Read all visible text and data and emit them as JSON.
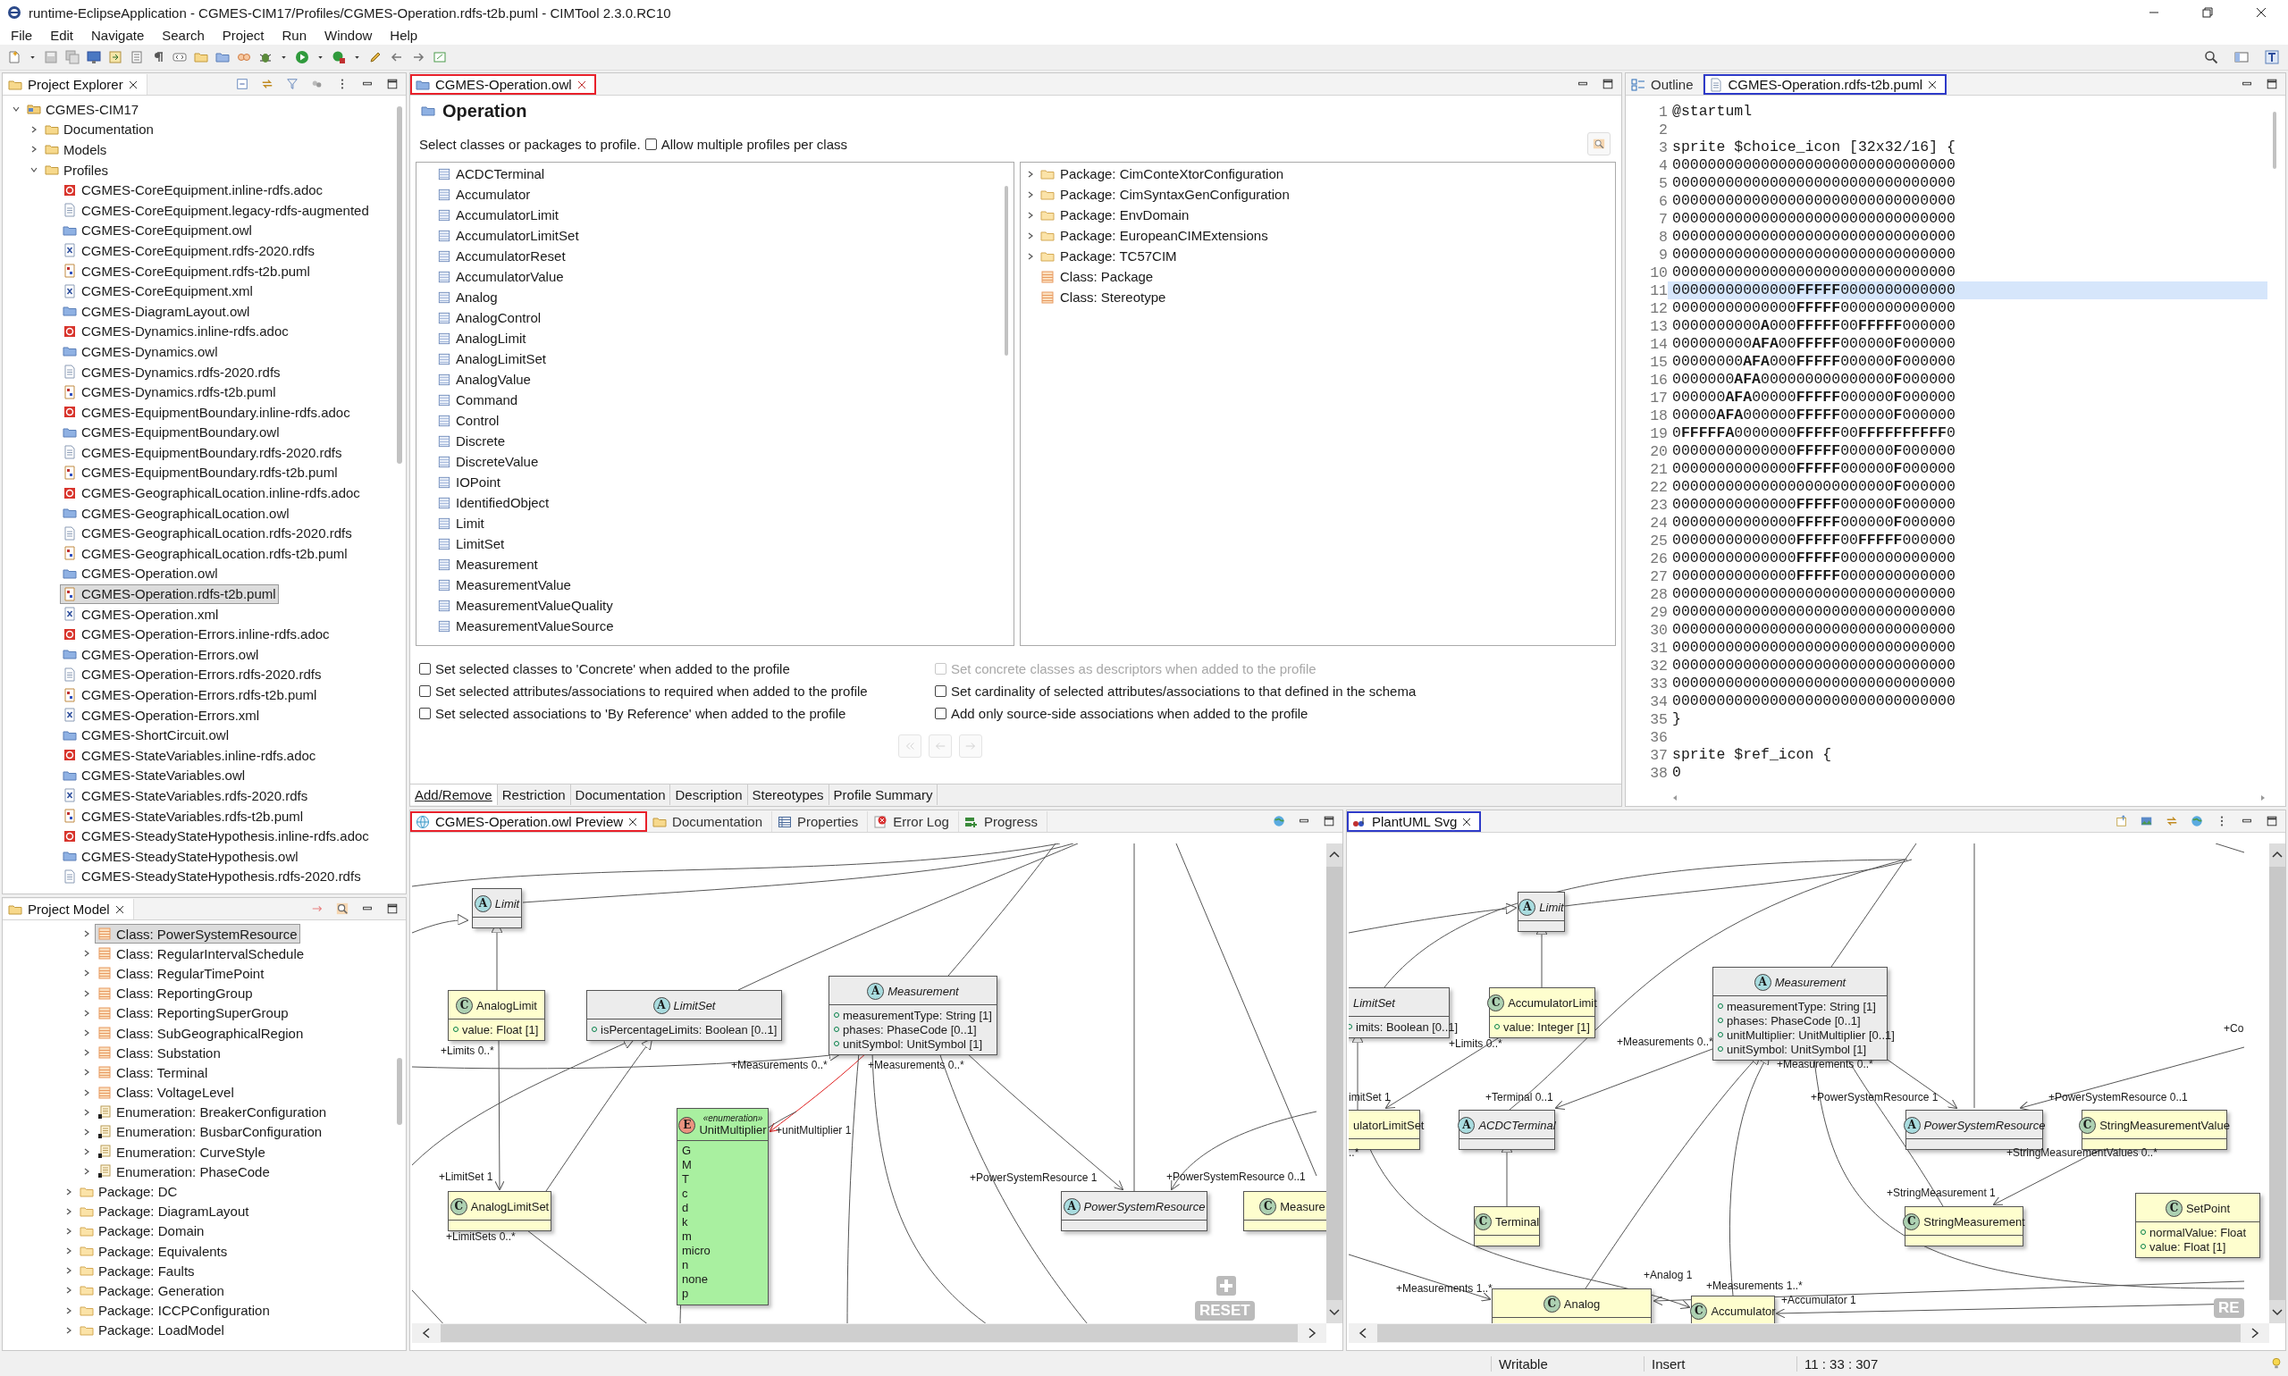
{
  "window": {
    "title": "runtime-EclipseApplication - CGMES-CIM17/Profiles/CGMES-Operation.rdfs-t2b.puml - CIMTool 2.3.0.RC10"
  },
  "menu": [
    "File",
    "Edit",
    "Navigate",
    "Search",
    "Project",
    "Run",
    "Window",
    "Help"
  ],
  "project_explorer": {
    "title": "Project Explorer",
    "tree": [
      {
        "label": "CGMES-CIM17",
        "kind": "project",
        "expanded": true,
        "selected": false,
        "children": [
          {
            "label": "Documentation",
            "kind": "folder",
            "expanded": false,
            "selected": false
          },
          {
            "label": "Models",
            "kind": "folder",
            "expanded": false,
            "selected": false
          },
          {
            "label": "Profiles",
            "kind": "folder",
            "expanded": true,
            "selected": false,
            "children": [
              {
                "label": "CGMES-CoreEquipment.inline-rdfs.adoc",
                "kind": "adoc",
                "selected": false
              },
              {
                "label": "CGMES-CoreEquipment.legacy-rdfs-augmented",
                "kind": "doc",
                "selected": false
              },
              {
                "label": "CGMES-CoreEquipment.owl",
                "kind": "owl",
                "selected": false
              },
              {
                "label": "CGMES-CoreEquipment.rdfs-2020.rdfs",
                "kind": "xml",
                "selected": false
              },
              {
                "label": "CGMES-CoreEquipment.rdfs-t2b.puml",
                "kind": "puml",
                "selected": false
              },
              {
                "label": "CGMES-CoreEquipment.xml",
                "kind": "xml",
                "selected": false
              },
              {
                "label": "CGMES-DiagramLayout.owl",
                "kind": "owl",
                "selected": false
              },
              {
                "label": "CGMES-Dynamics.inline-rdfs.adoc",
                "kind": "adoc",
                "selected": false
              },
              {
                "label": "CGMES-Dynamics.owl",
                "kind": "owl",
                "selected": false
              },
              {
                "label": "CGMES-Dynamics.rdfs-2020.rdfs",
                "kind": "doc",
                "selected": false
              },
              {
                "label": "CGMES-Dynamics.rdfs-t2b.puml",
                "kind": "puml",
                "selected": false
              },
              {
                "label": "CGMES-EquipmentBoundary.inline-rdfs.adoc",
                "kind": "adoc",
                "selected": false
              },
              {
                "label": "CGMES-EquipmentBoundary.owl",
                "kind": "owl",
                "selected": false
              },
              {
                "label": "CGMES-EquipmentBoundary.rdfs-2020.rdfs",
                "kind": "doc",
                "selected": false
              },
              {
                "label": "CGMES-EquipmentBoundary.rdfs-t2b.puml",
                "kind": "puml",
                "selected": false
              },
              {
                "label": "CGMES-GeographicalLocation.inline-rdfs.adoc",
                "kind": "adoc",
                "selected": false
              },
              {
                "label": "CGMES-GeographicalLocation.owl",
                "kind": "owl",
                "selected": false
              },
              {
                "label": "CGMES-GeographicalLocation.rdfs-2020.rdfs",
                "kind": "doc",
                "selected": false
              },
              {
                "label": "CGMES-GeographicalLocation.rdfs-t2b.puml",
                "kind": "puml",
                "selected": false
              },
              {
                "label": "CGMES-Operation.owl",
                "kind": "owl",
                "selected": false
              },
              {
                "label": "CGMES-Operation.rdfs-t2b.puml",
                "kind": "puml",
                "selected": true
              },
              {
                "label": "CGMES-Operation.xml",
                "kind": "xml",
                "selected": false
              },
              {
                "label": "CGMES-Operation-Errors.inline-rdfs.adoc",
                "kind": "adoc",
                "selected": false
              },
              {
                "label": "CGMES-Operation-Errors.owl",
                "kind": "owl",
                "selected": false
              },
              {
                "label": "CGMES-Operation-Errors.rdfs-2020.rdfs",
                "kind": "doc",
                "selected": false
              },
              {
                "label": "CGMES-Operation-Errors.rdfs-t2b.puml",
                "kind": "puml",
                "selected": false
              },
              {
                "label": "CGMES-Operation-Errors.xml",
                "kind": "xml",
                "selected": false
              },
              {
                "label": "CGMES-ShortCircuit.owl",
                "kind": "owl",
                "selected": false
              },
              {
                "label": "CGMES-StateVariables.inline-rdfs.adoc",
                "kind": "adoc",
                "selected": false
              },
              {
                "label": "CGMES-StateVariables.owl",
                "kind": "owl",
                "selected": false
              },
              {
                "label": "CGMES-StateVariables.rdfs-2020.rdfs",
                "kind": "xml",
                "selected": false
              },
              {
                "label": "CGMES-StateVariables.rdfs-t2b.puml",
                "kind": "puml",
                "selected": false
              },
              {
                "label": "CGMES-SteadyStateHypothesis.inline-rdfs.adoc",
                "kind": "adoc",
                "selected": false
              },
              {
                "label": "CGMES-SteadyStateHypothesis.owl",
                "kind": "owl",
                "selected": false
              },
              {
                "label": "CGMES-SteadyStateHypothesis.rdfs-2020.rdfs",
                "kind": "doc",
                "selected": false
              }
            ]
          }
        ]
      }
    ]
  },
  "project_model": {
    "title": "Project Model",
    "tree": [
      {
        "children": [
          {
            "label": "Class: PowerSystemResource",
            "kind": "class",
            "expanded": false,
            "selected": true
          },
          {
            "label": "Class: RegularIntervalSchedule",
            "kind": "class",
            "expanded": false,
            "selected": false
          },
          {
            "label": "Class: RegularTimePoint",
            "kind": "class",
            "expanded": false,
            "selected": false
          },
          {
            "label": "Class: ReportingGroup",
            "kind": "class",
            "expanded": false,
            "selected": false
          },
          {
            "label": "Class: ReportingSuperGroup",
            "kind": "class",
            "expanded": false,
            "selected": false
          },
          {
            "label": "Class: SubGeographicalRegion",
            "kind": "class",
            "expanded": false,
            "selected": false
          },
          {
            "label": "Class: Substation",
            "kind": "class",
            "expanded": false,
            "selected": false
          },
          {
            "label": "Class: Terminal",
            "kind": "class",
            "expanded": false,
            "selected": false
          },
          {
            "label": "Class: VoltageLevel",
            "kind": "class",
            "expanded": false,
            "selected": false
          },
          {
            "label": "Enumeration: BreakerConfiguration",
            "kind": "enum",
            "expanded": false,
            "selected": false
          },
          {
            "label": "Enumeration: BusbarConfiguration",
            "kind": "enum",
            "expanded": false,
            "selected": false
          },
          {
            "label": "Enumeration: CurveStyle",
            "kind": "enum",
            "expanded": false,
            "selected": false
          },
          {
            "label": "Enumeration: PhaseCode",
            "kind": "enum",
            "expanded": false,
            "selected": false
          }
        ]
      },
      {
        "label": "Package: DC",
        "kind": "package",
        "expanded": false,
        "selected": false
      },
      {
        "label": "Package: DiagramLayout",
        "kind": "package",
        "expanded": false,
        "selected": false
      },
      {
        "label": "Package: Domain",
        "kind": "package",
        "expanded": false,
        "selected": false
      },
      {
        "label": "Package: Equivalents",
        "kind": "package",
        "expanded": false,
        "selected": false
      },
      {
        "label": "Package: Faults",
        "kind": "package",
        "expanded": false,
        "selected": false
      },
      {
        "label": "Package: Generation",
        "kind": "package",
        "expanded": false,
        "selected": false
      },
      {
        "label": "Package: ICCPConfiguration",
        "kind": "package",
        "expanded": false,
        "selected": false
      },
      {
        "label": "Package: LoadModel",
        "kind": "package",
        "expanded": false,
        "selected": false
      }
    ]
  },
  "editor": {
    "tabs": [
      {
        "label": "CGMES-Operation.owl",
        "selected": true,
        "color": "#e8202a"
      }
    ],
    "heading": "Operation",
    "prompt": "Select classes or packages to profile.",
    "allow_multiple": {
      "label": "Allow multiple profiles per class",
      "checked": false
    },
    "classes": [
      "ACDCTerminal",
      "Accumulator",
      "AccumulatorLimit",
      "AccumulatorLimitSet",
      "AccumulatorReset",
      "AccumulatorValue",
      "Analog",
      "AnalogControl",
      "AnalogLimit",
      "AnalogLimitSet",
      "AnalogValue",
      "Command",
      "Control",
      "Discrete",
      "DiscreteValue",
      "IOPoint",
      "IdentifiedObject",
      "Limit",
      "LimitSet",
      "Measurement",
      "MeasurementValue",
      "MeasurementValueQuality",
      "MeasurementValueSource"
    ],
    "packages": [
      {
        "label": "Package: CimConteXtorConfiguration",
        "kind": "package",
        "expanded": false
      },
      {
        "label": "Package: CimSyntaxGenConfiguration",
        "kind": "package",
        "expanded": false
      },
      {
        "label": "Package: EnvDomain",
        "kind": "package",
        "expanded": false
      },
      {
        "label": "Package: EuropeanCIMExtensions",
        "kind": "package",
        "expanded": false
      },
      {
        "label": "Package: TC57CIM",
        "kind": "package",
        "expanded": false
      },
      {
        "label": "Class: Package",
        "kind": "class"
      },
      {
        "label": "Class: Stereotype",
        "kind": "class"
      }
    ],
    "options": [
      {
        "label": "Set selected classes to 'Concrete' when added to the profile",
        "checked": false,
        "disabled": false
      },
      {
        "label": "Set concrete classes as descriptors when added to the profile",
        "checked": false,
        "disabled": true
      },
      {
        "label": "Set selected attributes/associations to required when added to the profile",
        "checked": false,
        "disabled": false
      },
      {
        "label": "Set cardinality of selected attributes/associations to that defined in the schema",
        "checked": false,
        "disabled": false
      },
      {
        "label": "Set selected associations to 'By Reference' when added to the profile",
        "checked": false,
        "disabled": false
      },
      {
        "label": "Add only source-side associations when added to the profile",
        "checked": false,
        "disabled": false
      }
    ],
    "page_tabs": [
      {
        "label": "Add/Remove",
        "selected": true
      },
      {
        "label": "Restriction",
        "selected": false
      },
      {
        "label": "Documentation",
        "selected": false
      },
      {
        "label": "Description",
        "selected": false
      },
      {
        "label": "Stereotypes",
        "selected": false
      },
      {
        "label": "Profile Summary",
        "selected": false
      }
    ]
  },
  "source": {
    "tabs": [
      {
        "label": "Outline",
        "selected": false
      },
      {
        "label": "CGMES-Operation.rdfs-t2b.puml",
        "selected": true,
        "color": "#2e3ac8"
      }
    ],
    "lines": [
      {
        "n": "1",
        "text": "@startuml",
        "current": false
      },
      {
        "n": "2",
        "current": false
      },
      {
        "n": "3",
        "text": "sprite $choice_icon [32x32/16] {",
        "current": false
      },
      {
        "n": "4",
        "text": "00000000000000000000000000000000",
        "current": false
      },
      {
        "n": "5",
        "text": "00000000000000000000000000000000",
        "current": false
      },
      {
        "n": "6",
        "text": "00000000000000000000000000000000",
        "current": false
      },
      {
        "n": "7",
        "text": "00000000000000000000000000000000",
        "current": false
      },
      {
        "n": "8",
        "text": "00000000000000000000000000000000",
        "current": false
      },
      {
        "n": "9",
        "text": "00000000000000000000000000000000",
        "current": false
      },
      {
        "n": "10",
        "text": "00000000000000000000000000000000",
        "current": false
      },
      {
        "n": "11",
        "text": "00000000000000**FFFFF**0000000000000",
        "current": true
      },
      {
        "n": "12",
        "text": "00000000000000**FFFFF**0000000000000",
        "current": false
      },
      {
        "n": "13",
        "text": "0000000000**A**000**FFFFF**00**FFFFF**000000",
        "current": false
      },
      {
        "n": "14",
        "text": "000000000**AFA**00**FFFFF**000000**F**000000",
        "current": false
      },
      {
        "n": "15",
        "text": "00000000**AFA**000**FFFFF**000000**F**000000",
        "current": false
      },
      {
        "n": "16",
        "text": "0000000**AFA**000000000000000**F**000000",
        "current": false
      },
      {
        "n": "17",
        "text": "000000**AFA**00000**FFFFF**000000**F**000000",
        "current": false
      },
      {
        "n": "18",
        "text": "00000**AFA**000000**FFFFF**000000**F**000000",
        "current": false
      },
      {
        "n": "19",
        "text": "0**FFFFFA**0000000**FFFFF**00**FFFFFFFFFF**0",
        "current": false
      },
      {
        "n": "20",
        "text": "00000000000000**FFFFF**000000**F**000000",
        "current": false
      },
      {
        "n": "21",
        "text": "00000000000000**FFFFF**000000**F**000000",
        "current": false
      },
      {
        "n": "22",
        "text": "0000000000000000000000000**F**000000",
        "current": false
      },
      {
        "n": "23",
        "text": "00000000000000**FFFFF**000000**F**000000",
        "current": false
      },
      {
        "n": "24",
        "text": "00000000000000**FFFFF**000000**F**000000",
        "current": false
      },
      {
        "n": "25",
        "text": "00000000000000**FFFFF**00**FFFFF**000000",
        "current": false
      },
      {
        "n": "26",
        "text": "00000000000000**FFFFF**0000000000000",
        "current": false
      },
      {
        "n": "27",
        "text": "00000000000000**FFFFF**0000000000000",
        "current": false
      },
      {
        "n": "28",
        "text": "00000000000000000000000000000000",
        "current": false
      },
      {
        "n": "29",
        "text": "00000000000000000000000000000000",
        "current": false
      },
      {
        "n": "30",
        "text": "00000000000000000000000000000000",
        "current": false
      },
      {
        "n": "31",
        "text": "00000000000000000000000000000000",
        "current": false
      },
      {
        "n": "32",
        "text": "00000000000000000000000000000000",
        "current": false
      },
      {
        "n": "33",
        "text": "00000000000000000000000000000000",
        "current": false
      },
      {
        "n": "34",
        "text": "00000000000000000000000000000000",
        "current": false
      },
      {
        "n": "35",
        "text": "}",
        "current": false
      },
      {
        "n": "36",
        "current": false
      },
      {
        "n": "37",
        "text": "sprite $ref_icon {",
        "current": false
      },
      {
        "n": "38",
        "text": "0",
        "current": false
      }
    ]
  },
  "preview": {
    "tabs": [
      {
        "label": "CGMES-Operation.owl Preview",
        "selected": true,
        "color": "#e8202a"
      },
      {
        "label": "Documentation",
        "selected": false
      },
      {
        "label": "Properties",
        "selected": false
      },
      {
        "label": "Error Log",
        "selected": false
      },
      {
        "label": "Progress",
        "selected": false
      }
    ],
    "nodes": [
      {
        "kind": "abstract",
        "badge": "A",
        "name": "Limit"
      },
      {
        "kind": "class",
        "badge": "C",
        "name": "AnalogLimit",
        "attributes": [
          "value: Float [1]"
        ]
      },
      {
        "kind": "abstract",
        "badge": "A",
        "name": "LimitSet",
        "attributes": [
          "isPercentageLimits: Boolean [0..1]"
        ]
      },
      {
        "kind": "abstract",
        "badge": "A",
        "name": "Measurement",
        "attributes": [
          "measurementType: String [1]",
          "phases: PhaseCode [0..1]",
          "unitSymbol: UnitSymbol [1]"
        ]
      },
      {
        "kind": "class",
        "badge": "C",
        "name": "AnalogLimitSet"
      },
      {
        "kind": "enumeration",
        "badge": "E",
        "stereotype": "«enumeration»",
        "name": "UnitMultiplier",
        "values": [
          "G",
          "M",
          "T",
          "c",
          "d",
          "k",
          "m",
          "micro",
          "n",
          "none",
          "p"
        ]
      },
      {
        "kind": "abstract",
        "badge": "A",
        "name": "PowerSystemResource"
      },
      {
        "kind": "class",
        "badge": "C",
        "name": "Measure"
      }
    ],
    "labels": [
      "+Limits 0..*",
      "+Measurements 0..*",
      "+Measurements 0..*",
      "+unitMultiplier 1",
      "+LimitSet 1",
      "+LimitSets 0..*",
      "+PowerSystemResource 1",
      "+PowerSystemResource 0..1"
    ],
    "reset": "RESET"
  },
  "plantuml": {
    "tabs": [
      {
        "label": "PlantUML Svg",
        "selected": true,
        "color": "#2e3ac8"
      }
    ],
    "nodes": [
      {
        "kind": "abstract",
        "badge": "A",
        "name": "Limit"
      },
      {
        "kind": "abstract",
        "name": "LimitSet",
        "attributes": [
          "imits: Boolean [0..1]"
        ]
      },
      {
        "kind": "class",
        "badge": "C",
        "name": "AccumulatorLimit",
        "attributes": [
          "value: Integer [1]"
        ]
      },
      {
        "kind": "abstract",
        "badge": "A",
        "name": "Measurement",
        "attributes": [
          "measurementType: String [1]",
          "phases: PhaseCode [0..1]",
          "unitMultiplier: UnitMultiplier [0..1]",
          "unitSymbol: UnitSymbol [1]"
        ]
      },
      {
        "kind": "class",
        "name": "ulatorLimitSet"
      },
      {
        "kind": "abstract",
        "badge": "A",
        "name": "ACDCTerminal"
      },
      {
        "kind": "class",
        "badge": "C",
        "name": "Terminal"
      },
      {
        "kind": "abstract",
        "badge": "A",
        "name": "PowerSystemResource"
      },
      {
        "kind": "class",
        "badge": "C",
        "name": "StringMeasurementValue"
      },
      {
        "kind": "class",
        "badge": "C",
        "name": "StringMeasurement"
      },
      {
        "kind": "class",
        "badge": "C",
        "name": "SetPoint",
        "attributes": [
          "normalValue: Float",
          "value: Float [1]"
        ]
      },
      {
        "kind": "class",
        "badge": "C",
        "name": "Analog"
      },
      {
        "kind": "class",
        "badge": "C",
        "name": "Accumulator"
      }
    ],
    "labels": [
      "+Co",
      "+Limits 0..*",
      "+Measurements 0..*",
      "+Measurements 0..*",
      "imitSet 1",
      "+Terminal 0..1",
      "+PowerSystemResource 1",
      "+PowerSystemResource 0..1",
      "..*",
      "+StringMeasurementValues 0..*",
      "+StringMeasurement 1",
      "+Measurements 1..*",
      "+Analog 1",
      "+Measurements 1..*",
      "+Accumulator 1"
    ],
    "reset": "RE"
  },
  "status_bar": [
    "Writable",
    "Insert",
    "11 : 33 : 307"
  ]
}
